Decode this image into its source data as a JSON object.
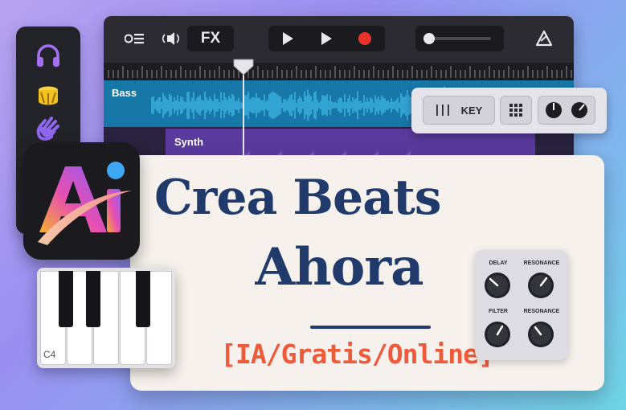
{
  "sidebar": {
    "items": [
      {
        "icon": "headphones-icon",
        "color": "#a66ef2"
      },
      {
        "icon": "drum-icon",
        "color": "#f2c21e"
      },
      {
        "icon": "hand-icon",
        "color": "#8f66f0"
      }
    ]
  },
  "daw": {
    "toolbar": {
      "fx_label": "FX",
      "icons": [
        "list-icon",
        "speaker-icon",
        "play-icon",
        "play-alt-icon",
        "record-icon",
        "volume-slider",
        "metronome-icon"
      ]
    },
    "tracks": [
      {
        "label": "Bass",
        "color": "#1778a8",
        "wave_color": "#3fb7e6"
      },
      {
        "label": "Synth",
        "color": "#5b3a9e"
      }
    ]
  },
  "key_panel": {
    "key_label": "KEY",
    "icons": [
      "bars-icon",
      "grid-icon",
      "knob-pair-icon"
    ]
  },
  "logo": {
    "text": "Ai",
    "colors": [
      "#f5b12f",
      "#e84fb0",
      "#8e5cf7",
      "#3fa8f5"
    ]
  },
  "card": {
    "line1": "Crea Beats",
    "line2": "Ahora",
    "subtitle": "[IA/Gratis/Online]",
    "title_color": "#1f3a6b",
    "subtitle_color": "#ee5a3a"
  },
  "knobs_panel": {
    "labels": [
      "DELAY",
      "RESONANCE",
      "FILTER",
      "RESONANCE"
    ]
  },
  "piano": {
    "note_label": "C4"
  }
}
